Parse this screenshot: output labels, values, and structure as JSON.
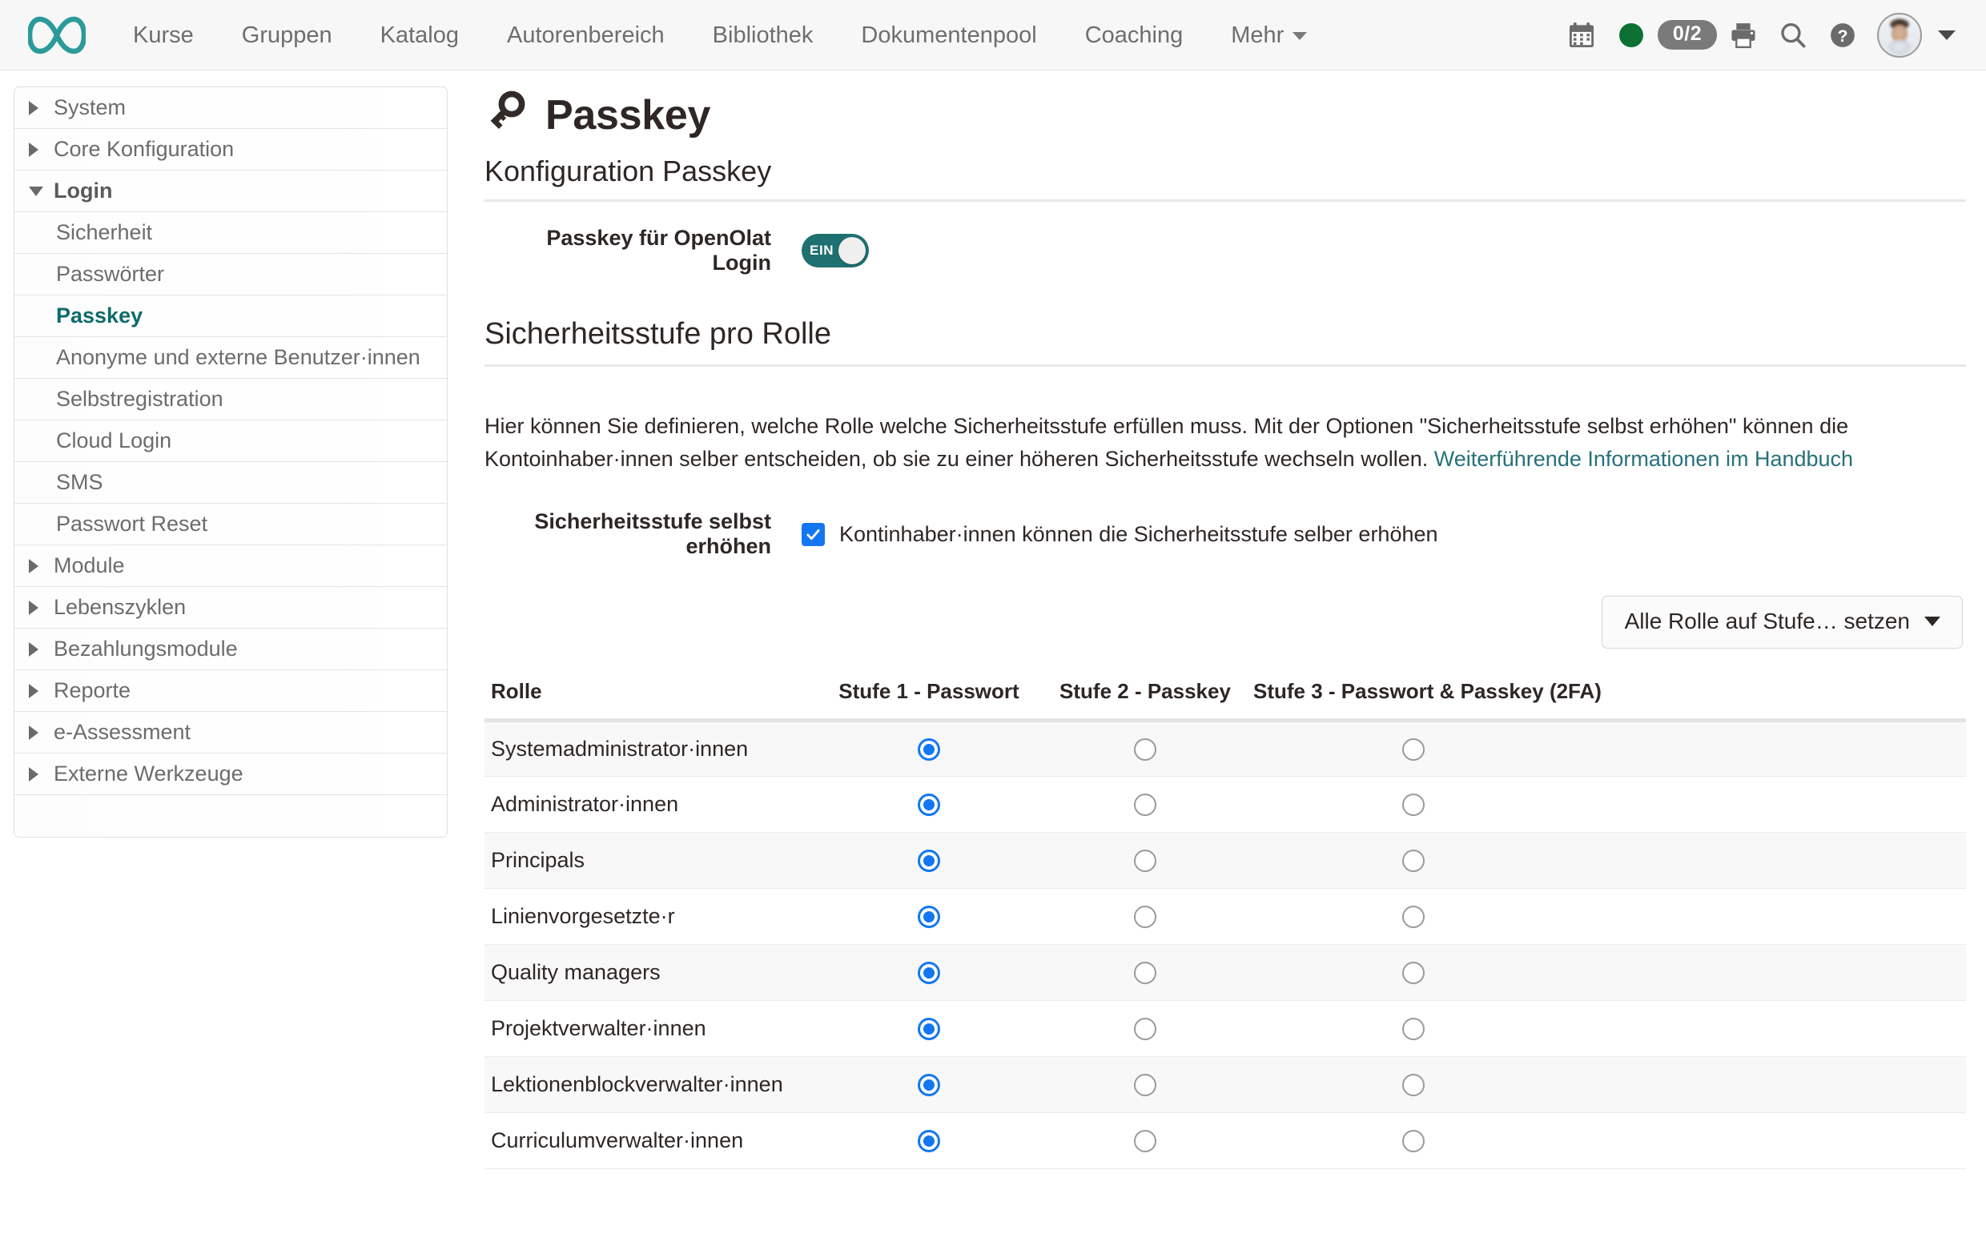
{
  "header": {
    "logo_icon": "infinity-logo",
    "nav": [
      {
        "label": "Kurse"
      },
      {
        "label": "Gruppen"
      },
      {
        "label": "Katalog"
      },
      {
        "label": "Autorenbereich"
      },
      {
        "label": "Bibliothek"
      },
      {
        "label": "Dokumentenpool"
      },
      {
        "label": "Coaching"
      },
      {
        "label": "Mehr"
      }
    ],
    "tools": {
      "calendar_icon": "calendar-icon",
      "status_dot": "online-status-dot",
      "counter_badge": "0/2",
      "print_icon": "printer-icon",
      "search_icon": "search-icon",
      "help_icon": "help-icon",
      "avatar": "user-avatar"
    },
    "colors": {
      "logo_teal": "#2c9a9a",
      "status_green": "#0c7132",
      "badge_gray": "#7a7a7a"
    }
  },
  "sidebar": {
    "groups": [
      {
        "label": "System",
        "expanded": false,
        "children": []
      },
      {
        "label": "Core Konfiguration",
        "expanded": false,
        "children": []
      },
      {
        "label": "Login",
        "expanded": true,
        "children": [
          {
            "label": "Sicherheit",
            "active": false
          },
          {
            "label": "Passwörter",
            "active": false
          },
          {
            "label": "Passkey",
            "active": true
          },
          {
            "label": "Anonyme und externe Benutzer·innen",
            "active": false
          },
          {
            "label": "Selbstregistration",
            "active": false
          },
          {
            "label": "Cloud Login",
            "active": false
          },
          {
            "label": "SMS",
            "active": false
          },
          {
            "label": "Passwort Reset",
            "active": false
          }
        ]
      },
      {
        "label": "Module",
        "expanded": false,
        "children": []
      },
      {
        "label": "Lebenszyklen",
        "expanded": false,
        "children": []
      },
      {
        "label": "Bezahlungsmodule",
        "expanded": false,
        "children": []
      },
      {
        "label": "Reporte",
        "expanded": false,
        "children": []
      },
      {
        "label": "e-Assessment",
        "expanded": false,
        "children": []
      },
      {
        "label": "Externe Werkzeuge",
        "expanded": false,
        "children": []
      }
    ],
    "active_item_color": "#0f6b6b"
  },
  "main": {
    "page_title": "Passkey",
    "page_title_icon": "key-icon",
    "section1_heading": "Konfiguration Passkey",
    "passkey_toggle": {
      "label": "Passkey für OpenOlat Login",
      "state_text": "EIN",
      "enabled": true,
      "color": "#1f7070"
    },
    "section2_heading": "Sicherheitsstufe pro Rolle",
    "description_part1": "Hier können Sie definieren, welche Rolle welche Sicherheitsstufe erfüllen muss. Mit der Optionen \"Sicherheitsstufe selbst erhöhen\" können die Kontoinhaber·innen selber entscheiden, ob sie zu einer höheren Sicherheitsstufe wechseln wollen. ",
    "description_link": "Weiterführende Informationen im Handbuch",
    "link_color": "#26717a",
    "self_raise": {
      "label": "Sicherheitsstufe selbst erhöhen",
      "checkbox_text": "Kontinhaber·innen können die Sicherheitsstufe selber erhöhen",
      "checked": true,
      "color": "#1377f2"
    },
    "set_all_button": "Alle Rolle auf Stufe… setzen",
    "table": {
      "columns": [
        "Rolle",
        "Stufe 1 - Passwort",
        "Stufe 2 - Passkey",
        "Stufe 3 - Passwort & Passkey (2FA)"
      ],
      "rows": [
        {
          "role": "Systemadministrator·innen",
          "selected": 1
        },
        {
          "role": "Administrator·innen",
          "selected": 1
        },
        {
          "role": "Principals",
          "selected": 1
        },
        {
          "role": "Linienvorgesetzte·r",
          "selected": 1
        },
        {
          "role": "Quality managers",
          "selected": 1
        },
        {
          "role": "Projektverwalter·innen",
          "selected": 1
        },
        {
          "role": "Lektionenblockverwalter·innen",
          "selected": 1
        },
        {
          "role": "Curriculumverwalter·innen",
          "selected": 1
        }
      ],
      "radio_selected_color": "#1377f2"
    }
  }
}
